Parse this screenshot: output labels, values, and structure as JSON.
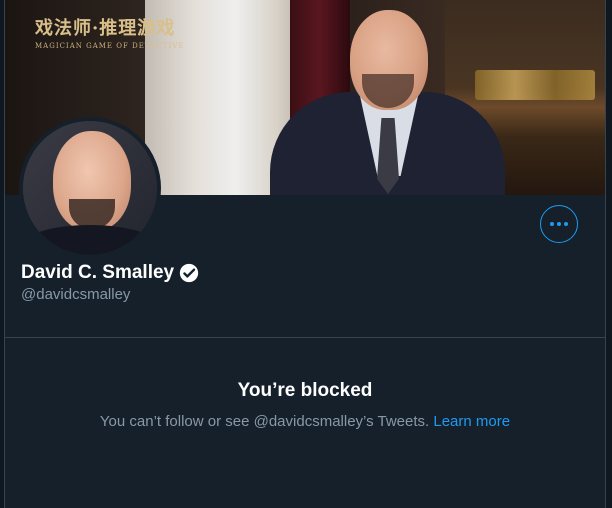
{
  "banner": {
    "logo_text": "戏法师·推理游戏",
    "logo_subtitle": "MAGICIAN GAME OF DETECTIVE"
  },
  "profile": {
    "display_name": "David C. Smalley",
    "handle": "@davidcsmalley",
    "verified": true
  },
  "actions": {
    "more_label": "More"
  },
  "blocked": {
    "title": "You’re blocked",
    "message": "You can’t follow or see @davidcsmalley’s Tweets. ",
    "learn_more": "Learn more"
  },
  "colors": {
    "background": "#15202b",
    "accent": "#1d9bf0",
    "secondary_text": "#8899a6",
    "border": "#38444d"
  },
  "icons": {
    "more": "more-horizontal-icon",
    "verified": "verified-badge-icon"
  }
}
